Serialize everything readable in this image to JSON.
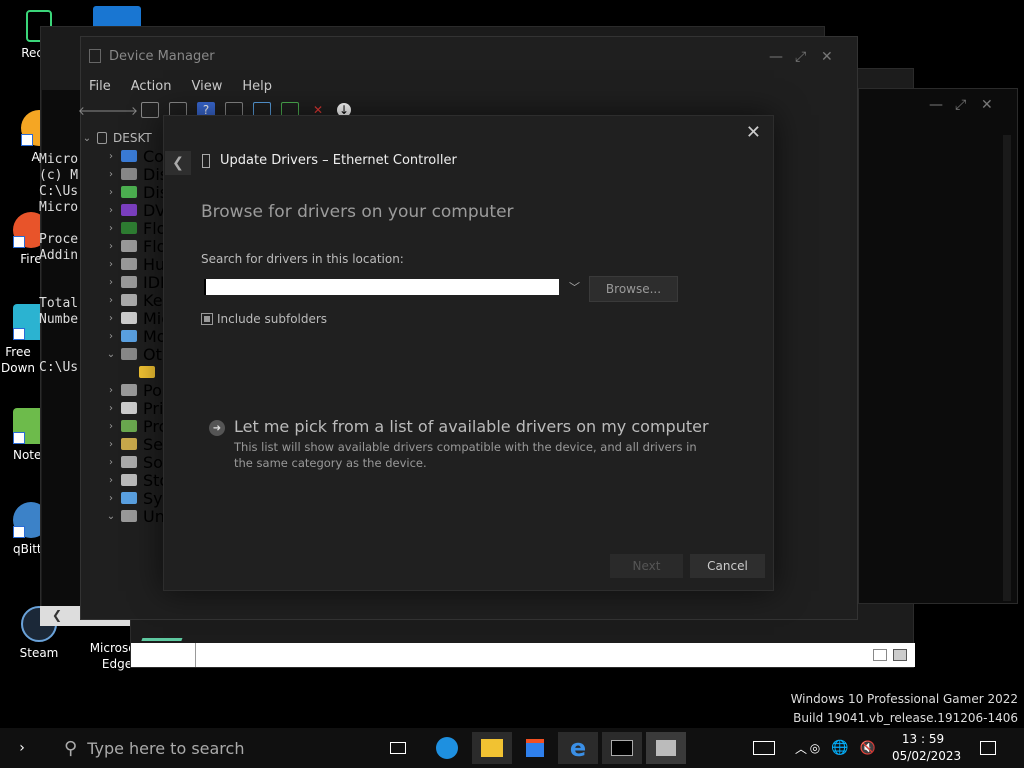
{
  "desktop_icons": [
    {
      "label": "Recyc",
      "icon": "recycle-bin-icon"
    },
    {
      "label": "Fire",
      "icon": "firefox-icon"
    },
    {
      "label": "Free Down",
      "icon": "free-download-manager-icon"
    },
    {
      "label": "Notep",
      "icon": "notepad-icon"
    },
    {
      "label": "qBitto",
      "icon": "qbittorrent-icon"
    },
    {
      "label": "Steam",
      "icon": "steam-icon"
    },
    {
      "label": "Microsoft Edge",
      "icon": "edge-icon"
    },
    {
      "label": "All",
      "icon": "app-icon"
    }
  ],
  "console_lines": [
    "Micro",
    "(c) M",
    "",
    "C:\\Us",
    "Micro",
    "",
    "Proce",
    "Addin",
    "",
    "",
    "Total",
    "Numbe",
    "",
    "",
    "C:\\Us"
  ],
  "device_manager": {
    "title": "Device Manager",
    "menu": [
      "File",
      "Action",
      "View",
      "Help"
    ],
    "tree_root": "DESKT",
    "tree_items": [
      {
        "label": "Cor",
        "icon": "computer-icon",
        "expanded": false
      },
      {
        "label": "Disk",
        "icon": "disk-drive-icon",
        "expanded": false
      },
      {
        "label": "Disp",
        "icon": "display-adapter-icon",
        "expanded": false
      },
      {
        "label": "DVD",
        "icon": "dvd-drive-icon",
        "expanded": false
      },
      {
        "label": "Flop",
        "icon": "floppy-controller-icon",
        "expanded": false
      },
      {
        "label": "Flop",
        "icon": "floppy-drive-icon",
        "expanded": false
      },
      {
        "label": "Hun",
        "icon": "hid-icon",
        "expanded": false
      },
      {
        "label": "IDE",
        "icon": "ide-controller-icon",
        "expanded": false
      },
      {
        "label": "Key",
        "icon": "keyboard-icon",
        "expanded": false
      },
      {
        "label": "Mic",
        "icon": "mouse-icon",
        "expanded": false
      },
      {
        "label": "Mo",
        "icon": "monitor-icon",
        "expanded": false
      },
      {
        "label": "Oth",
        "icon": "other-devices-icon",
        "expanded": true
      },
      {
        "label": "",
        "icon": "warning-device-icon",
        "expanded": false
      },
      {
        "label": "Por",
        "icon": "ports-icon",
        "expanded": false
      },
      {
        "label": "Prin",
        "icon": "printer-icon",
        "expanded": false
      },
      {
        "label": "Pro",
        "icon": "processor-icon",
        "expanded": false
      },
      {
        "label": "Ser",
        "icon": "security-device-icon",
        "expanded": false
      },
      {
        "label": "Sof",
        "icon": "software-device-icon",
        "expanded": false
      },
      {
        "label": "Sto",
        "icon": "storage-controller-icon",
        "expanded": false
      },
      {
        "label": "Syst",
        "icon": "system-device-icon",
        "expanded": false
      },
      {
        "label": "Uni",
        "icon": "usb-controller-icon",
        "expanded": true
      }
    ]
  },
  "dialog": {
    "title": "Update Drivers – Ethernet Controller",
    "heading": "Browse for drivers on your computer",
    "search_label": "Search for drivers in this location:",
    "path_value": "",
    "browse_label": "Browse...",
    "include_subfolders_label": "Include subfolders",
    "include_subfolders_checked": true,
    "pick_title": "Let me pick from a list of available drivers on my computer",
    "pick_description": "This list will show available drivers compatible with the device, and all drivers in the same category as the device.",
    "next_label": "Next",
    "cancel_label": "Cancel",
    "close_glyph": "✕"
  },
  "watermark": {
    "line1": "Windows 10 Professional Gamer 2022",
    "line2": "Build 19041.vb_release.191206-1406"
  },
  "taskbar": {
    "search_placeholder": "Type here to search",
    "time": "13 : 59",
    "date": "05/02/2023"
  }
}
